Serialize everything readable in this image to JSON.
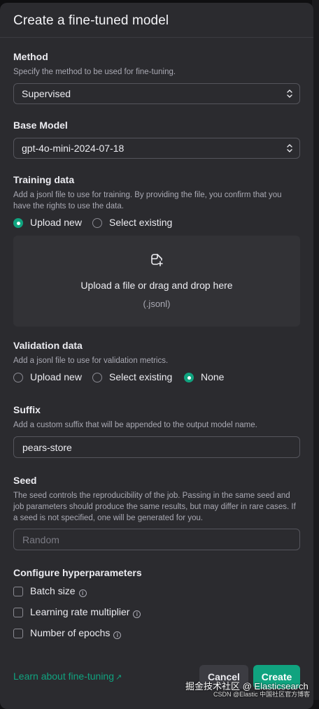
{
  "modal": {
    "title": "Create a fine-tuned model"
  },
  "method": {
    "label": "Method",
    "description": "Specify the method to be used for fine-tuning.",
    "value": "Supervised"
  },
  "base_model": {
    "label": "Base Model",
    "value": "gpt-4o-mini-2024-07-18"
  },
  "training_data": {
    "label": "Training data",
    "description": "Add a jsonl file to use for training. By providing the file, you confirm that you have the rights to use the data.",
    "options": [
      {
        "label": "Upload new",
        "selected": true
      },
      {
        "label": "Select existing",
        "selected": false
      }
    ],
    "dropzone_text": "Upload a file or drag and drop here",
    "dropzone_subtext": "(.jsonl)"
  },
  "validation_data": {
    "label": "Validation data",
    "description": "Add a jsonl file to use for validation metrics.",
    "options": [
      {
        "label": "Upload new",
        "selected": false
      },
      {
        "label": "Select existing",
        "selected": false
      },
      {
        "label": "None",
        "selected": true
      }
    ]
  },
  "suffix": {
    "label": "Suffix",
    "description": "Add a custom suffix that will be appended to the output model name.",
    "value": "pears-store"
  },
  "seed": {
    "label": "Seed",
    "description": "The seed controls the reproducibility of the job. Passing in the same seed and job parameters should produce the same results, but may differ in rare cases. If a seed is not specified, one will be generated for you.",
    "placeholder": "Random"
  },
  "hyperparameters": {
    "label": "Configure hyperparameters",
    "items": [
      {
        "label": "Batch size",
        "checked": false
      },
      {
        "label": "Learning rate multiplier",
        "checked": false
      },
      {
        "label": "Number of epochs",
        "checked": false
      }
    ]
  },
  "footer": {
    "learn_link": "Learn about fine-tuning",
    "cancel_label": "Cancel",
    "create_label": "Create"
  },
  "watermark": {
    "line1": "掘金技术社区 @ Elasticsearch",
    "line2": "CSDN @Elastic 中国社区官方博客"
  },
  "colors": {
    "accent": "#10a37f",
    "modal_bg": "#2b2b2f"
  },
  "icons": {
    "select_chevrons": "chevron-up-down-icon",
    "upload": "file-plus-icon",
    "info": "info-icon",
    "external_link": "arrow-up-right-icon"
  }
}
